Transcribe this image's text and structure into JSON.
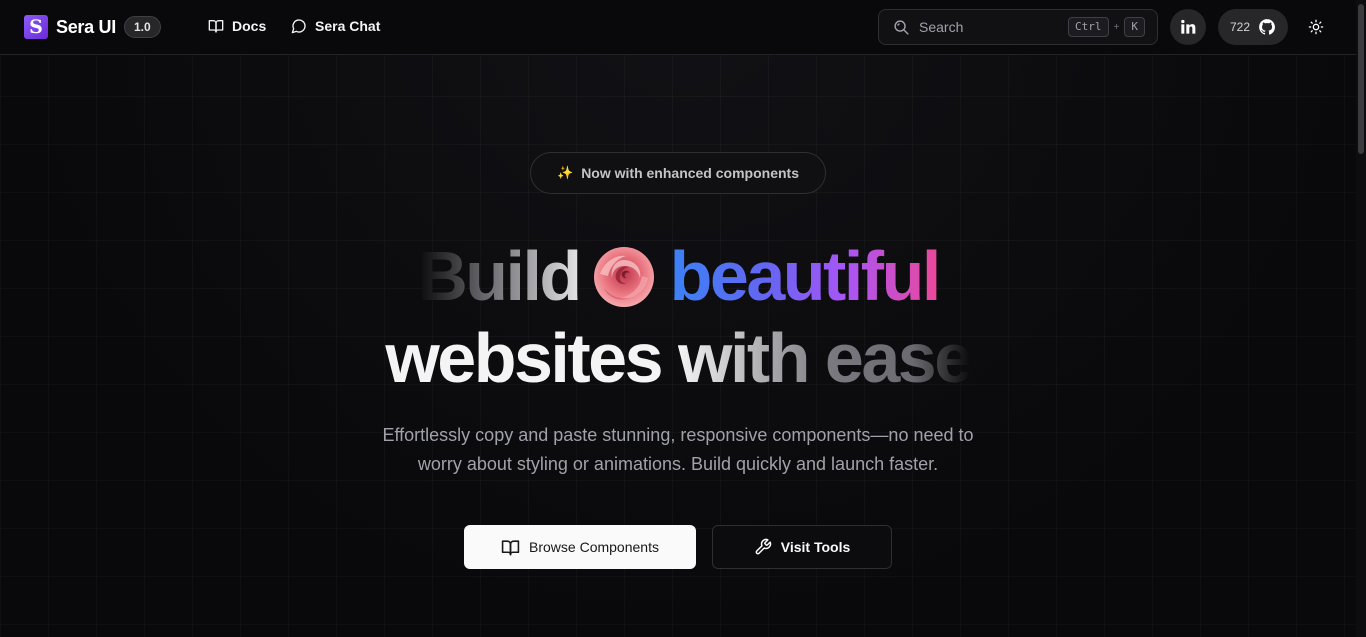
{
  "header": {
    "logo_letter": "S",
    "brand": "Sera UI",
    "version": "1.0",
    "nav": [
      {
        "label": "Docs",
        "icon": "book-open-icon"
      },
      {
        "label": "Sera Chat",
        "icon": "chat-bubble-icon"
      }
    ],
    "search": {
      "placeholder": "Search",
      "shortcut_key1": "Ctrl",
      "shortcut_plus": "+",
      "shortcut_key2": "K"
    },
    "linkedin_icon": "linkedin-icon",
    "github_stars": "722",
    "github_icon": "github-icon",
    "theme_icon": "sun-icon"
  },
  "hero": {
    "badge": {
      "icon": "sparkles-icon",
      "text": "Now with enhanced components"
    },
    "headline": {
      "word1": "Build",
      "emoji": "rose",
      "word2": "beautiful",
      "word3": "websites",
      "word4": "with",
      "word5": "ease"
    },
    "subtitle_line1": "Effortlessly copy and paste stunning, responsive components—no need to",
    "subtitle_line2": "worry about styling or animations. Build quickly and launch faster.",
    "primary_button": {
      "label": "Browse Components",
      "icon": "book-open-icon"
    },
    "secondary_button": {
      "label": "Visit Tools",
      "icon": "wrench-icon"
    }
  },
  "colors": {
    "accent_purple": "#8b5cf6",
    "gradient_blue": "#3b82f6",
    "gradient_pink": "#ec4899",
    "background": "#09090b"
  }
}
